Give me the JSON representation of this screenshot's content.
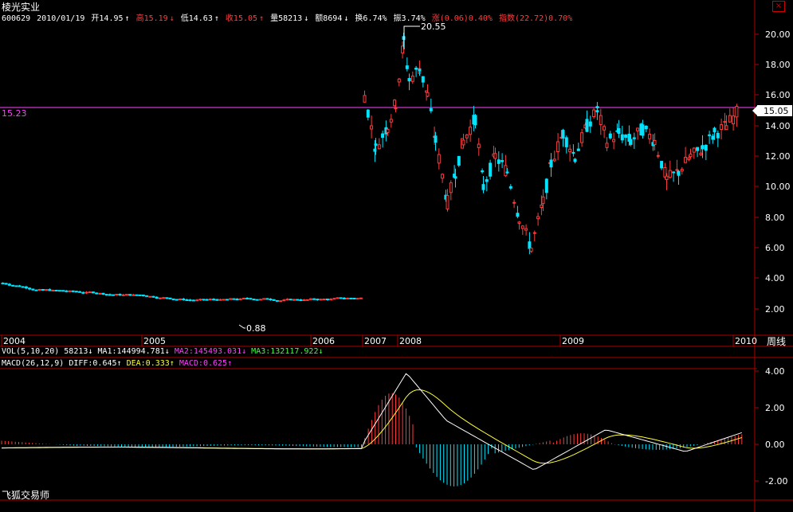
{
  "app": {
    "stock_name": "棱光实业",
    "brand": "飞狐交易师",
    "period_label": "周线",
    "close_icon": "close-icon"
  },
  "header": {
    "code": "600629",
    "date": "2010/01/19",
    "open": "开14.95",
    "open_arrow": "↑",
    "high": "高15.19",
    "high_arrow": "↓",
    "low": "低14.63",
    "low_arrow": "↑",
    "close": "收15.05",
    "close_arrow": "↑",
    "volume": "量58213",
    "volume_arrow": "↓",
    "amount": "额8694",
    "amount_arrow": "↓",
    "turnover": "换6.74%",
    "amplitude": "振3.74%",
    "change": "涨(0.06)0.40%",
    "index": "指数(22.72)0.70%"
  },
  "price_panel": {
    "y_ticks": [
      "20.00",
      "18.00",
      "16.00",
      "14.00",
      "12.00",
      "10.00",
      "8.00",
      "6.00",
      "4.00",
      "2.00"
    ],
    "hline_value": "15.23",
    "last_price": "15.05",
    "max_label": "20.55",
    "min_label": "0.88",
    "x_labels": [
      "2004",
      "2005",
      "2006",
      "2007",
      "2008",
      "2009",
      "2010"
    ]
  },
  "vol_line": {
    "label": "VOL(5,10,20)",
    "value": "58213",
    "value_arrow": "↓",
    "ma1": "MA1:144994.781",
    "ma1_arrow": "↓",
    "ma2": "MA2:145493.031",
    "ma2_arrow": "↓",
    "ma3": "MA3:132117.922",
    "ma3_arrow": "↓"
  },
  "macd_line": {
    "label": "MACD(26,12,9)",
    "diff": "DIFF:0.645",
    "diff_arrow": "↑",
    "dea": "DEA:0.333",
    "dea_arrow": "↑",
    "macd": "MACD:0.625",
    "macd_arrow": "↑"
  },
  "macd_panel": {
    "y_ticks": [
      "4.00",
      "2.00",
      "0.00",
      "-2.00"
    ]
  },
  "colors": {
    "up": "#ff3c3c",
    "down": "#00e5ff",
    "axis": "#b00000",
    "hline": "#ff40ff",
    "diff": "#ffffff",
    "dea": "#ffff3c"
  }
}
